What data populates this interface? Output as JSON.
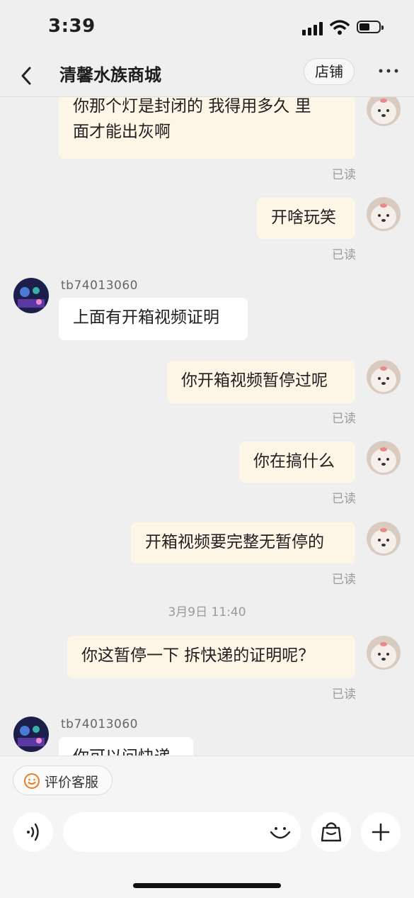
{
  "status_bar": {
    "time": "3:39"
  },
  "header": {
    "title": "清馨水族商城",
    "store_label": "店铺"
  },
  "messages": {
    "m1": {
      "line1": "你那个灯是封闭的  我得用多久  里",
      "line2": "面才能出灰啊",
      "read": "已读"
    },
    "m2": {
      "text": "开啥玩笑",
      "read": "已读"
    },
    "m3": {
      "username": "tb74013060",
      "text": "上面有开箱视频证明"
    },
    "m4": {
      "text": "你开箱视频暂停过呢",
      "read": "已读"
    },
    "m5": {
      "text": "你在搞什么",
      "read": "已读"
    },
    "m6": {
      "text": "开箱视频要完整无暂停的",
      "read": "已读"
    },
    "timestamp": "3月9日 11:40",
    "m7": {
      "text": "你这暂停一下   拆快递的证明呢？",
      "read": "已读"
    },
    "m8": {
      "username": "tb74013060",
      "text": "你可以问快递"
    }
  },
  "bottom": {
    "rate_label": "评价客服",
    "icons": [
      "voice-icon",
      "emoji-icon",
      "shopping-bag-icon",
      "plus-icon"
    ]
  },
  "colors": {
    "my_bubble": "#fdf5e6",
    "their_bubble": "#ffffff",
    "background": "#efeff0",
    "accent": "#f07a1e"
  }
}
